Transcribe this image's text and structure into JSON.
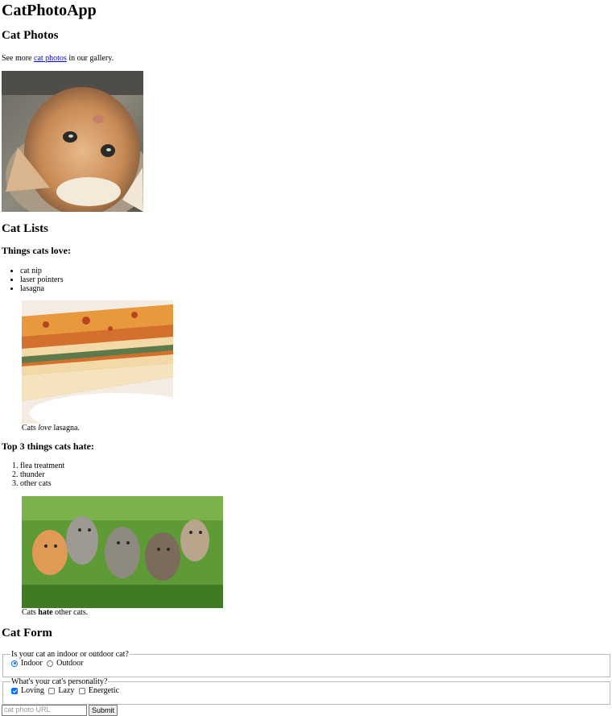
{
  "app": {
    "title": "CatPhotoApp"
  },
  "photos_section": {
    "heading": "Cat Photos",
    "text_before": "See more ",
    "link_text": "cat photos",
    "text_after": " in our gallery."
  },
  "lists_section": {
    "heading": "Cat Lists",
    "love": {
      "heading": "Things cats love:",
      "items": [
        "cat nip",
        "laser pointers",
        "lasagna"
      ],
      "caption_before": "Cats ",
      "caption_em": "love",
      "caption_after": " lasagna."
    },
    "hate": {
      "heading": "Top 3 things cats hate:",
      "items": [
        "flea treatment",
        "thunder",
        "other cats"
      ],
      "caption_before": "Cats ",
      "caption_strong": "hate",
      "caption_after": " other cats."
    }
  },
  "form_section": {
    "heading": "Cat Form",
    "location": {
      "legend": "Is your cat an indoor or outdoor cat?",
      "options": [
        {
          "label": "Indoor",
          "checked": true
        },
        {
          "label": "Outdoor",
          "checked": false
        }
      ]
    },
    "personality": {
      "legend": "What's your cat's personality?",
      "options": [
        {
          "label": "Loving",
          "checked": true
        },
        {
          "label": "Lazy",
          "checked": false
        },
        {
          "label": "Energetic",
          "checked": false
        }
      ]
    },
    "url_placeholder": "cat photo URL",
    "submit_label": "Submit"
  },
  "colors": {
    "link": "#0000ee",
    "accent": "#0075ff"
  }
}
